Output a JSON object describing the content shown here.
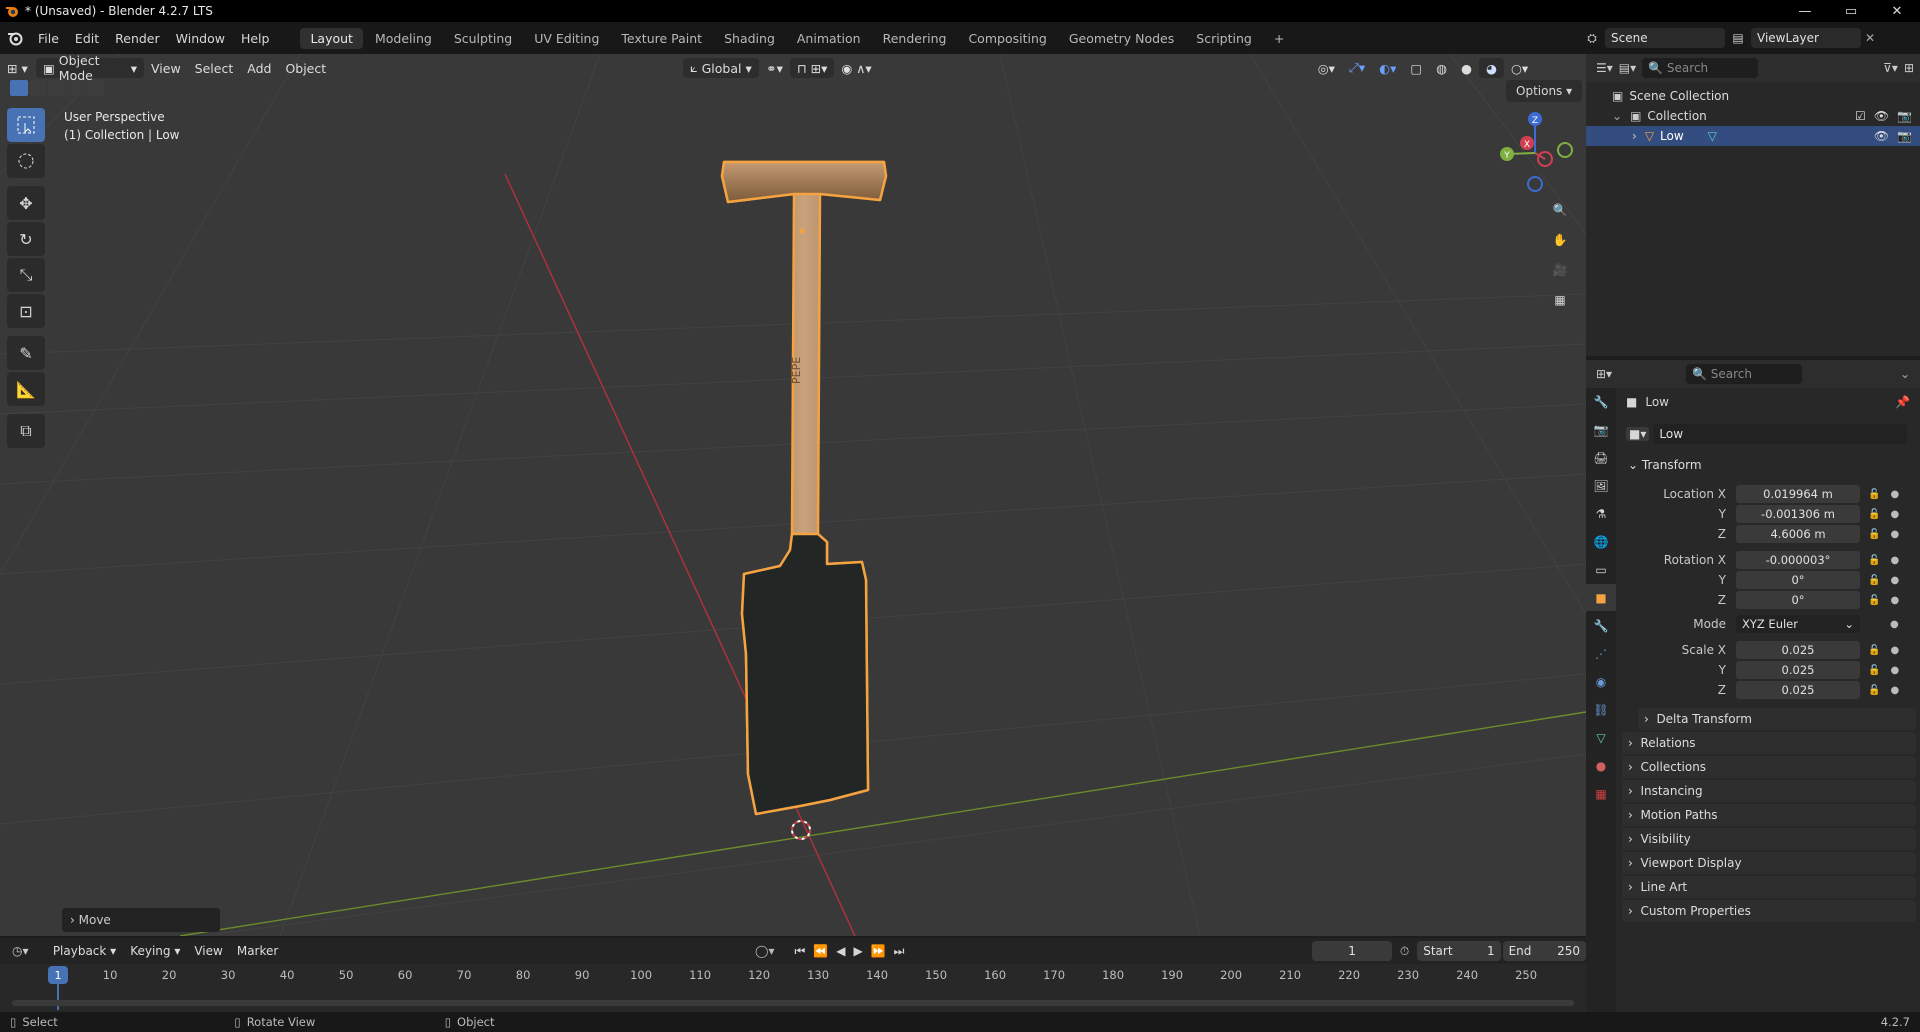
{
  "window": {
    "title": "* (Unsaved) - Blender 4.2.7 LTS",
    "controls": [
      "—",
      "▭",
      "✕"
    ]
  },
  "menubar": {
    "menus": [
      "File",
      "Edit",
      "Render",
      "Window",
      "Help"
    ],
    "workspaces": [
      "Layout",
      "Modeling",
      "Sculpting",
      "UV Editing",
      "Texture Paint",
      "Shading",
      "Animation",
      "Rendering",
      "Compositing",
      "Geometry Nodes",
      "Scripting"
    ],
    "active_workspace": "Layout",
    "add_workspace": "+",
    "scene": "Scene",
    "view_layer": "ViewLayer"
  },
  "viewport": {
    "mode": "Object Mode",
    "menus": [
      "View",
      "Select",
      "Add",
      "Object"
    ],
    "orientation": "Global",
    "options": "Options",
    "overlay_line1": "User Perspective",
    "overlay_line2": "(1) Collection | Low",
    "last_op": "Move",
    "handle_text": "PEPE",
    "axes": {
      "x": "X",
      "y": "Y",
      "z": "Z"
    }
  },
  "outliner": {
    "search_placeholder": "Search",
    "root": "Scene Collection",
    "collection": "Collection",
    "object": "Low"
  },
  "properties": {
    "search_placeholder": "Search",
    "object_name": "Low",
    "datablock": "Low",
    "transform_header": "Transform",
    "location_label": "Location X",
    "location": [
      "0.019964 m",
      "-0.001306 m",
      "4.6006 m"
    ],
    "rotation_label": "Rotation X",
    "rotation": [
      "-0.000003°",
      "0°",
      "0°"
    ],
    "mode_label": "Mode",
    "mode_value": "XYZ Euler",
    "scale_label": "Scale X",
    "scale": [
      "0.025",
      "0.025",
      "0.025"
    ],
    "y_label": "Y",
    "z_label": "Z",
    "delta": "Delta Transform",
    "sections": [
      "Relations",
      "Collections",
      "Instancing",
      "Motion Paths",
      "Visibility",
      "Viewport Display",
      "Line Art",
      "Custom Properties"
    ]
  },
  "timeline": {
    "menus": [
      "Playback",
      "Keying",
      "View",
      "Marker"
    ],
    "current_frame": "1",
    "start_label": "Start",
    "start": "1",
    "end_label": "End",
    "end": "250",
    "ticks": [
      "1",
      "10",
      "20",
      "30",
      "40",
      "50",
      "60",
      "70",
      "80",
      "90",
      "100",
      "110",
      "120",
      "130",
      "140",
      "150",
      "160",
      "170",
      "180",
      "190",
      "200",
      "210",
      "220",
      "230",
      "240",
      "250"
    ]
  },
  "statusbar": {
    "select": "Select",
    "rotate": "Rotate View",
    "object": "Object",
    "version": "4.2.7"
  },
  "colors": {
    "accent": "#4772b3",
    "selection_outline": "#f5a340",
    "x_axis": "#b3323a",
    "y_axis": "#6b8c2a"
  }
}
